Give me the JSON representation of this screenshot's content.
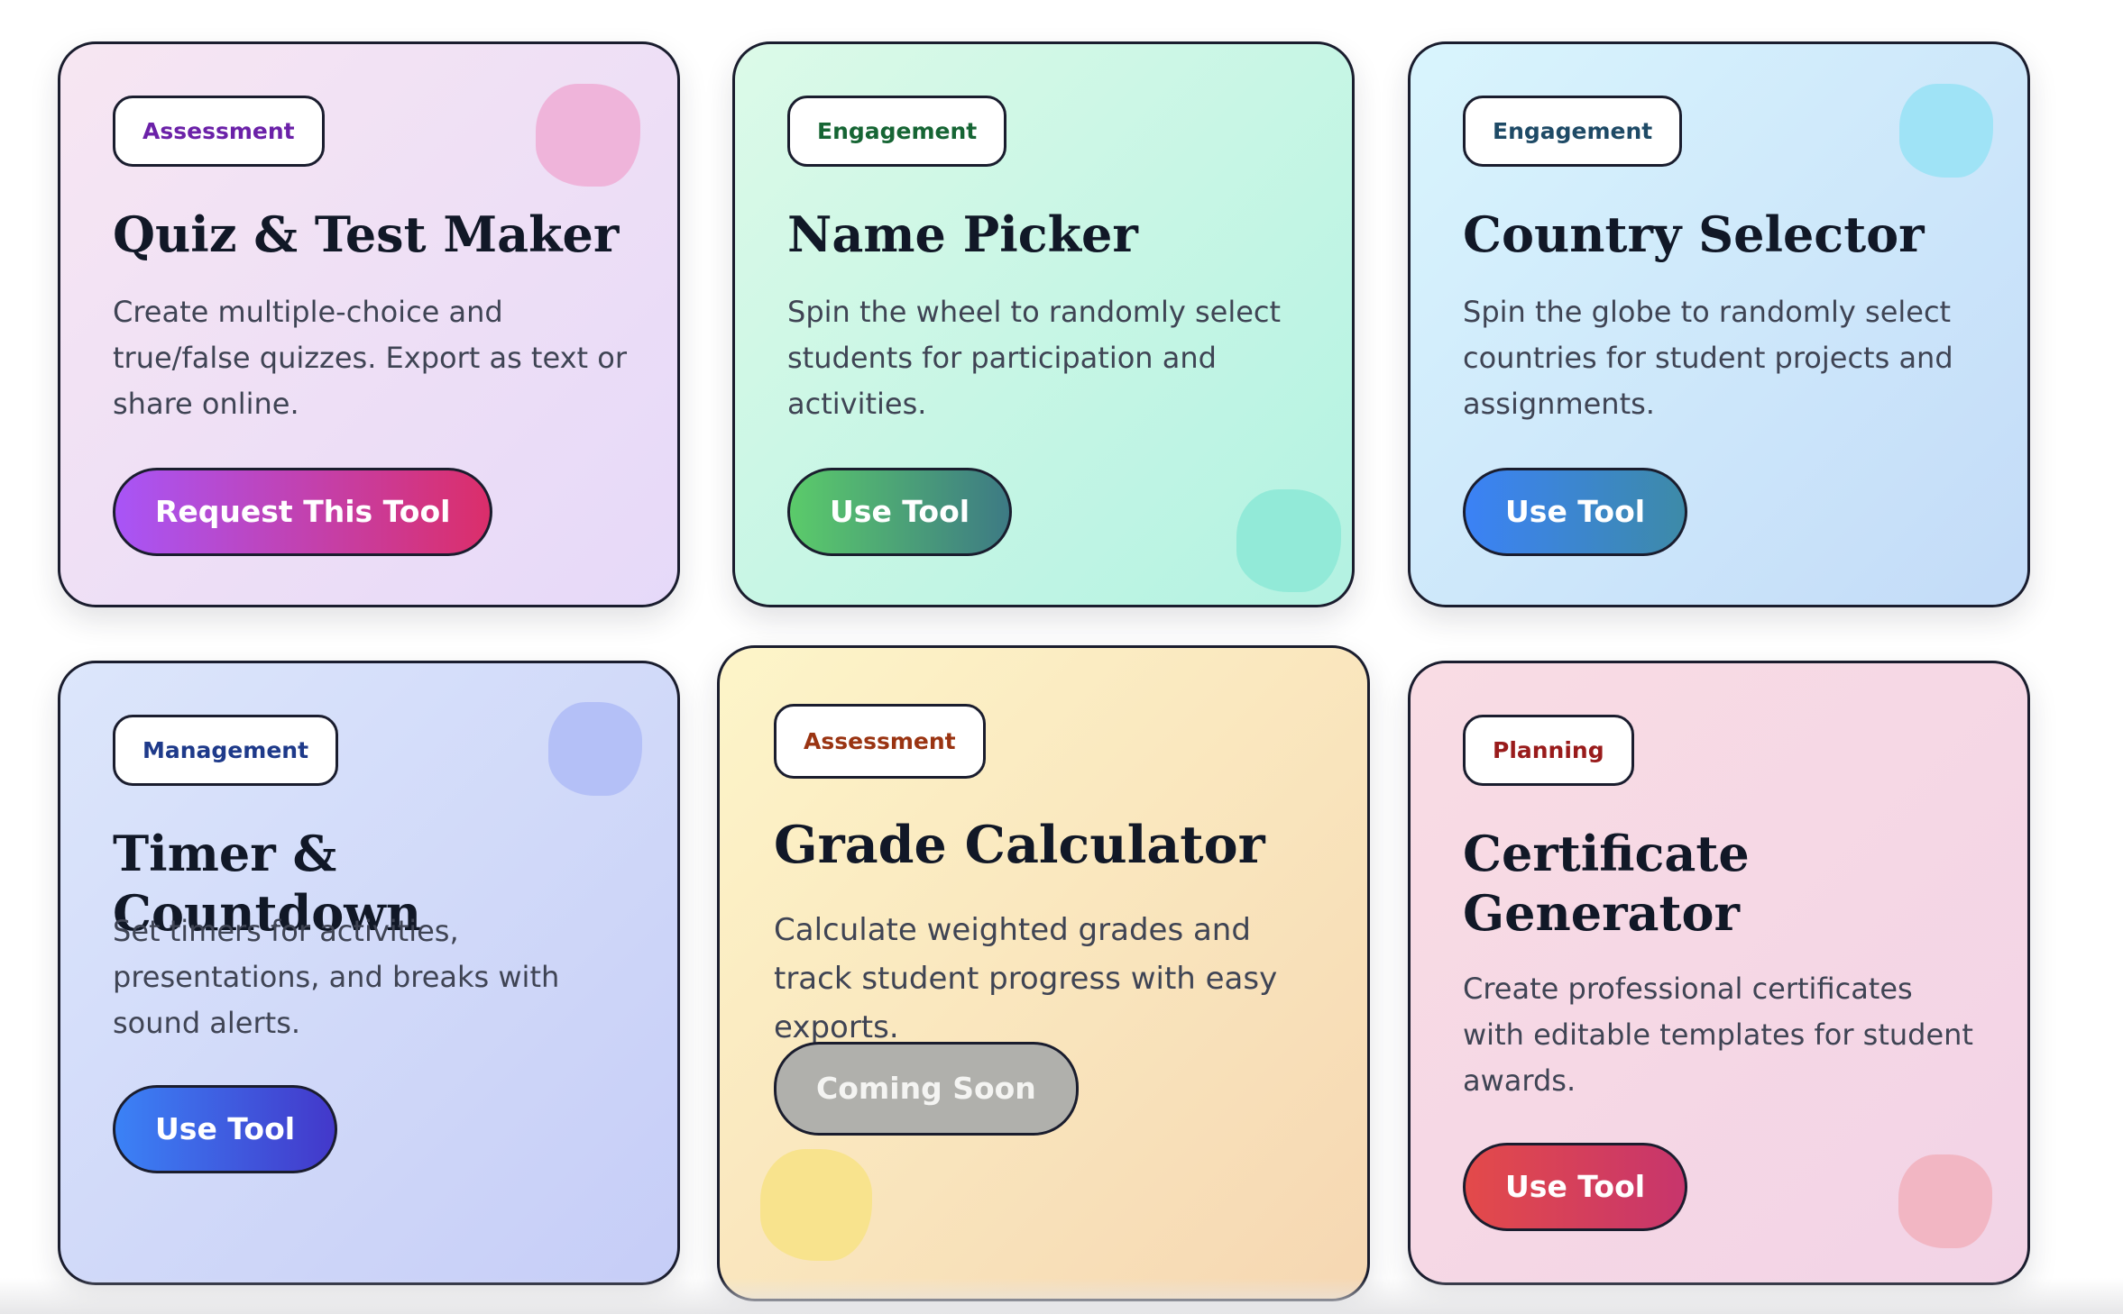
{
  "cards": [
    {
      "category": "Assessment",
      "title": "Quiz & Test Maker",
      "description": "Create multiple-choice and true/false quizzes. Export as text or share online.",
      "button": "Request This Tool",
      "colors": {
        "tag_text": "#6b21a8",
        "button_from": "#a855f7",
        "button_to": "#db2e6a",
        "blob": "#efb4da"
      }
    },
    {
      "category": "Engagement",
      "title": "Name Picker",
      "description": "Spin the wheel to randomly select students for participation and activities.",
      "button": "Use Tool",
      "colors": {
        "tag_text": "#166534",
        "button_from": "#5bcb6a",
        "button_to": "#3d7a84",
        "blob": "#92ead8"
      }
    },
    {
      "category": "Engagement",
      "title": "Country Selector",
      "description": "Spin the globe to randomly select countries for student projects and assignments.",
      "button": "Use Tool",
      "colors": {
        "tag_text": "#1e4a66",
        "button_from": "#3b82f6",
        "button_to": "#3d8aa8",
        "blob": "#9fe3f6"
      }
    },
    {
      "category": "Management",
      "title": "Timer & Countdown",
      "description": "Set timers for activities, presentations, and breaks with sound alerts.",
      "button": "Use Tool",
      "colors": {
        "tag_text": "#1e3a8a",
        "button_from": "#3b82f6",
        "button_to": "#4338ca",
        "blob": "#b4c0f7"
      }
    },
    {
      "category": "Assessment",
      "title": "Grade Calculator",
      "description": "Calculate weighted grades and track student progress with easy exports.",
      "button": "Coming Soon",
      "colors": {
        "tag_text": "#9a3412",
        "button_from": "#b0b0ac",
        "button_to": "#b0b0ac",
        "blob": "#f8e38d"
      }
    },
    {
      "category": "Planning",
      "title": "Certificate Generator",
      "description": "Create professional certificates with editable templates for student awards.",
      "button": "Use Tool",
      "colors": {
        "tag_text": "#991b1b",
        "button_from": "#e34a4a",
        "button_to": "#c7356c",
        "blob": "#f2b6c3"
      }
    }
  ]
}
